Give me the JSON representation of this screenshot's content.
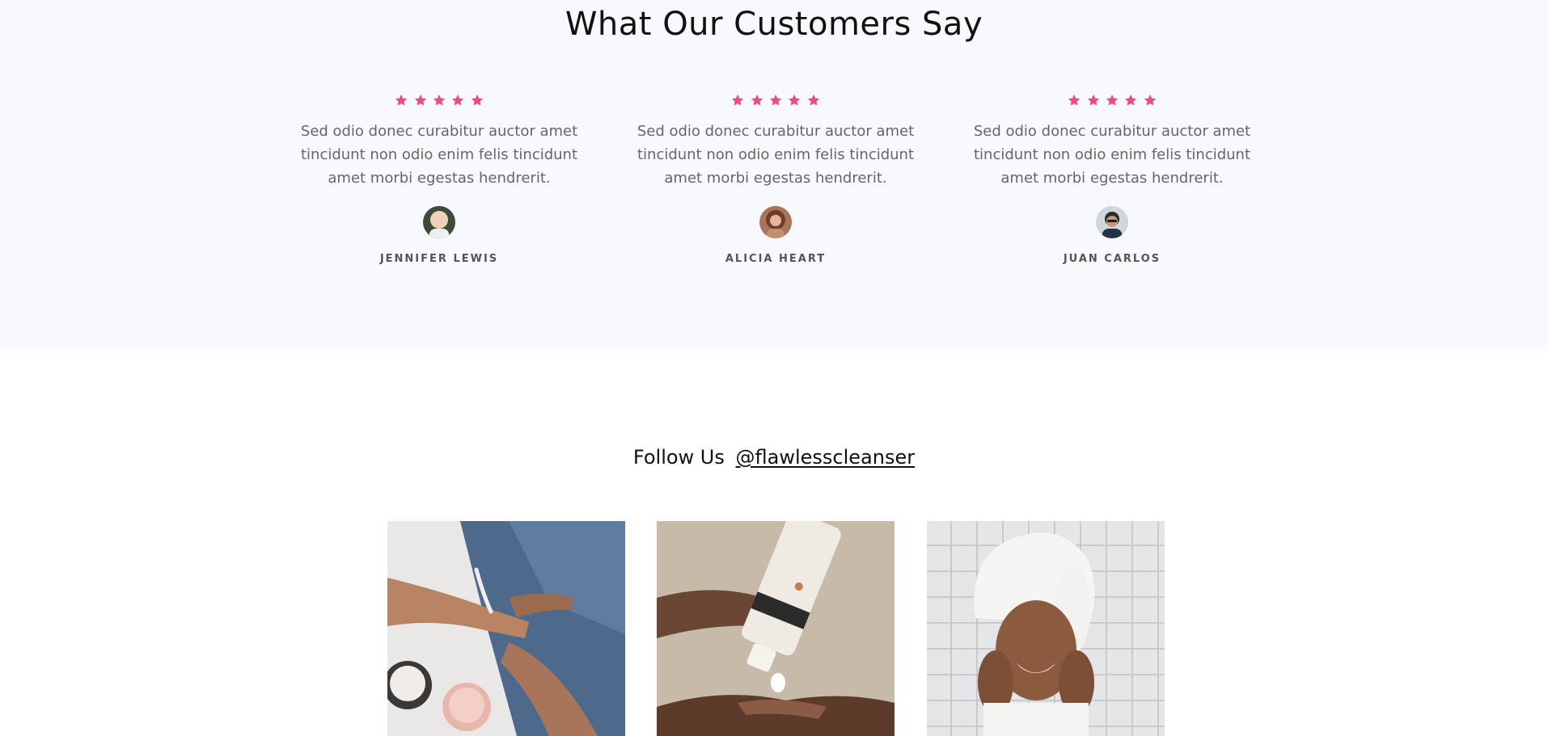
{
  "testimonials": {
    "title": "What Our Customers Say",
    "star_color": "#ee4a7e",
    "reviews": [
      {
        "rating": 5,
        "text": "Sed odio donec curabitur auctor amet tincidunt non odio enim felis tincidunt amet morbi egestas hendrerit.",
        "name": "JENNIFER LEWIS",
        "avatar": "woman-portrait"
      },
      {
        "rating": 5,
        "text": "Sed odio donec curabitur auctor amet tincidunt non odio enim felis tincidunt amet morbi egestas hendrerit.",
        "name": "ALICIA HEART",
        "avatar": "woman-portrait"
      },
      {
        "rating": 5,
        "text": "Sed odio donec curabitur auctor amet tincidunt non odio enim felis tincidunt amet morbi egestas hendrerit.",
        "name": "JUAN CARLOS",
        "avatar": "man-portrait"
      }
    ]
  },
  "follow": {
    "label": "Follow Us",
    "handle": "@flawlesscleanser"
  },
  "gallery": [
    {
      "image": "applying-lotion-on-arm-photo"
    },
    {
      "image": "cleanser-tube-squeeze-photo"
    },
    {
      "image": "smiling-woman-towel-photo"
    }
  ]
}
